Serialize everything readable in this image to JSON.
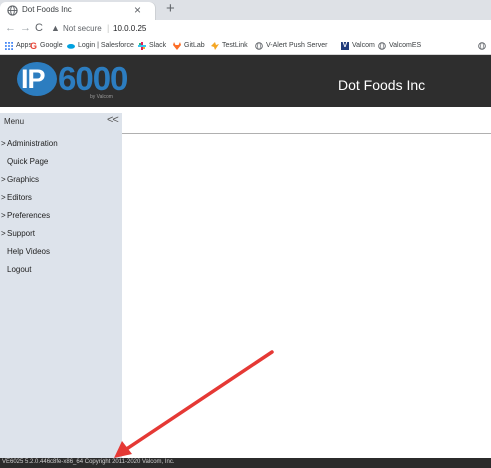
{
  "browser": {
    "tab_title": "Dot Foods Inc",
    "close_glyph": "×",
    "new_tab_glyph": "+",
    "nav": {
      "back": "←",
      "forward": "→",
      "reload": "C"
    },
    "address": {
      "security_label": "Not secure",
      "separator": "|",
      "url": "10.0.0.25"
    },
    "bookmarks": [
      {
        "label": "Apps",
        "icon": "apps-grid-icon",
        "color": "#4285f4"
      },
      {
        "label": "Google",
        "icon": "google-icon",
        "color": "#ea4335"
      },
      {
        "label": "Login | Salesforce",
        "icon": "salesforce-cloud-icon",
        "color": "#00a1e0"
      },
      {
        "label": "Slack",
        "icon": "slack-icon",
        "color": "#e01e5a"
      },
      {
        "label": "GitLab",
        "icon": "gitlab-fox-icon",
        "color": "#fc6d26"
      },
      {
        "label": "TestLink",
        "icon": "testlink-icon",
        "color": "#f5a623"
      },
      {
        "label": "V-Alert Push Server",
        "icon": "globe-icon",
        "color": "#5f6368"
      },
      {
        "label": "Valcom",
        "icon": "valcom-v-icon",
        "color": "#1f3a7a"
      },
      {
        "label": "ValcomES",
        "icon": "globe-icon",
        "color": "#5f6368"
      }
    ]
  },
  "app": {
    "logo": {
      "ip": "IP",
      "number": "6000",
      "by": "by Valcom"
    },
    "title": "Dot Foods Inc",
    "brand_color": "#2c7dc0"
  },
  "sidebar": {
    "menu_label": "Menu",
    "collapse_glyph": "<<",
    "items": [
      {
        "label": "Administration",
        "expandable": true
      },
      {
        "label": "Quick Page",
        "expandable": false
      },
      {
        "label": "Graphics",
        "expandable": true
      },
      {
        "label": "Editors",
        "expandable": true
      },
      {
        "label": "Preferences",
        "expandable": true
      },
      {
        "label": "Support",
        "expandable": true
      },
      {
        "label": "Help Videos",
        "expandable": false
      },
      {
        "label": "Logout",
        "expandable": false
      }
    ]
  },
  "footer": {
    "text": "VE6025 5.2.0.446c8fe-x86_64  Copyright 2011-2020 Valcom, Inc."
  },
  "annotation": {
    "arrow_color": "#e53935"
  }
}
